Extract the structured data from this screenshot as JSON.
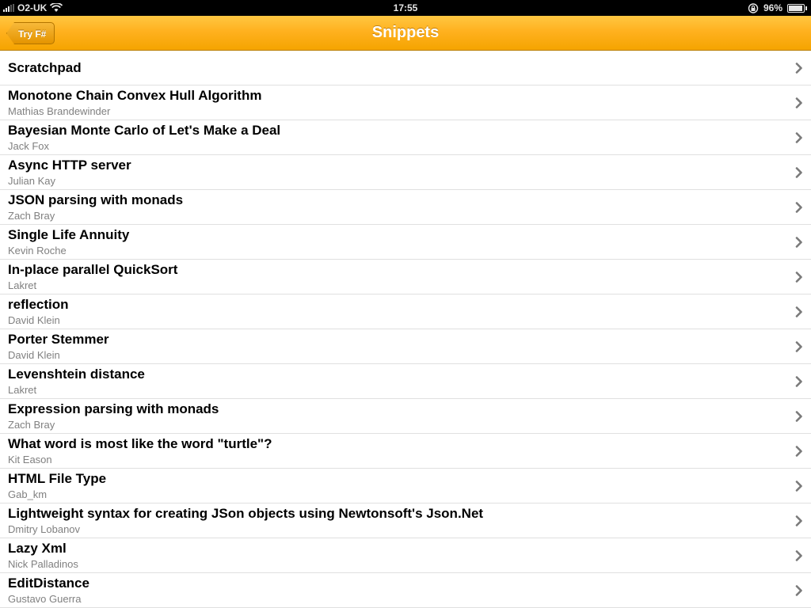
{
  "status_bar": {
    "carrier": "O2-UK",
    "time": "17:55",
    "battery_percent": "96%",
    "battery_level": 0.96,
    "icons": [
      "signal-icon",
      "wifi-icon",
      "rotation-lock-icon",
      "battery-icon"
    ]
  },
  "nav_bar": {
    "title": "Snippets",
    "back_label": "Try F#",
    "accent_color": "#ffb11f"
  },
  "snippets": [
    {
      "title": "Scratchpad",
      "author": ""
    },
    {
      "title": "Monotone Chain Convex Hull Algorithm",
      "author": "Mathias Brandewinder"
    },
    {
      "title": "Bayesian Monte Carlo of Let's Make a Deal",
      "author": "Jack Fox"
    },
    {
      "title": "Async HTTP server",
      "author": "Julian Kay"
    },
    {
      "title": "JSON parsing with monads",
      "author": "Zach Bray"
    },
    {
      "title": "Single Life Annuity",
      "author": "Kevin Roche"
    },
    {
      "title": "In-place parallel QuickSort",
      "author": "Lakret"
    },
    {
      "title": "reflection",
      "author": "David Klein"
    },
    {
      "title": "Porter Stemmer",
      "author": "David Klein"
    },
    {
      "title": "Levenshtein distance",
      "author": "Lakret"
    },
    {
      "title": "Expression parsing with monads",
      "author": "Zach Bray"
    },
    {
      "title": "What word is most like the word \"turtle\"?",
      "author": "Kit Eason"
    },
    {
      "title": "HTML File Type",
      "author": "Gab_km"
    },
    {
      "title": "Lightweight syntax for creating JSon objects using Newtonsoft's Json.Net",
      "author": "Dmitry Lobanov"
    },
    {
      "title": "Lazy Xml",
      "author": "Nick Palladinos"
    },
    {
      "title": "EditDistance",
      "author": "Gustavo Guerra"
    }
  ]
}
